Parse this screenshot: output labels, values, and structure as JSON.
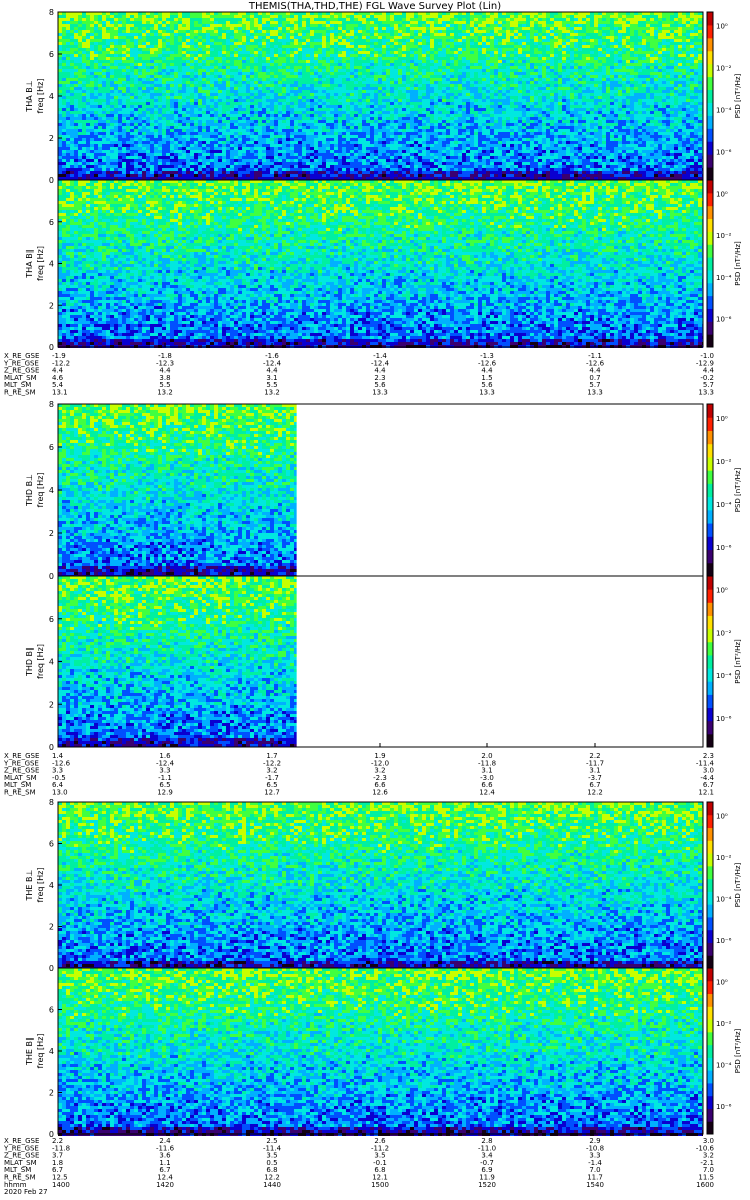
{
  "title": "THEMIS(THA,THD,THE) FGL Wave Survey Plot (Lin)",
  "colors": {
    "colormap": [
      "#140014",
      "#3a0070",
      "#0a00d0",
      "#0050ff",
      "#00b0ff",
      "#00e8e0",
      "#00f0a0",
      "#40ff40",
      "#c8ff00",
      "#ffe000",
      "#ff9000",
      "#ff2000",
      "#c00000"
    ],
    "unfilled": "#ffffff",
    "axis": "#000000"
  },
  "chart_data": [
    {
      "type": "heatmap",
      "group": "THA",
      "panels": [
        {
          "ylabel": "THA B⊥",
          "ylabel2": "freq [Hz]",
          "ylim": [
            0,
            8
          ],
          "yticks": [
            "0",
            "2",
            "4",
            "6",
            "8"
          ],
          "cbar_label": "PSD [nT²/Hz]",
          "cbar_ticks": [
            "10⁰",
            "10⁻²",
            "10⁻⁴",
            "10⁻⁶"
          ],
          "data_coverage": 1.0
        },
        {
          "ylabel": "THA B∥",
          "ylabel2": "freq [Hz]",
          "ylim": [
            0,
            8
          ],
          "yticks": [
            "0",
            "2",
            "4",
            "6"
          ],
          "cbar_label": "PSD [nT²/Hz]",
          "cbar_ticks": [
            "10⁰",
            "10⁻²",
            "10⁻⁴",
            "10⁻⁶"
          ],
          "data_coverage": 1.0
        }
      ],
      "ephemeris": {
        "labels": [
          "X_RE_GSE",
          "Y_RE_GSE",
          "Z_RE_GSE",
          "MLAT_SM",
          "MLT_SM",
          "R_RE_SM"
        ],
        "rows": [
          [
            "-1.9",
            "-1.8",
            "-1.6",
            "-1.4",
            "-1.3",
            "-1.1",
            "-1.0"
          ],
          [
            "-12.2",
            "-12.3",
            "-12.4",
            "-12.4",
            "-12.6",
            "-12.6",
            "-12.9"
          ],
          [
            "4.4",
            "4.4",
            "4.4",
            "4.4",
            "4.4",
            "4.4",
            "4.4"
          ],
          [
            "4.6",
            "3.8",
            "3.1",
            "2.3",
            "1.5",
            "0.7",
            "-0.2"
          ],
          [
            "5.4",
            "5.5",
            "5.5",
            "5.6",
            "5.6",
            "5.7",
            "5.7"
          ],
          [
            "13.1",
            "13.2",
            "13.2",
            "13.3",
            "13.3",
            "13.3",
            "13.3"
          ]
        ]
      }
    },
    {
      "type": "heatmap",
      "group": "THD",
      "panels": [
        {
          "ylabel": "THD B⊥",
          "ylabel2": "freq [Hz]",
          "ylim": [
            0,
            8
          ],
          "yticks": [
            "0",
            "2",
            "4",
            "6",
            "8"
          ],
          "cbar_label": "PSD [nT²/Hz]",
          "cbar_ticks": [
            "10⁰",
            "10⁻²",
            "10⁻⁴",
            "10⁻⁶"
          ],
          "data_coverage": 0.37
        },
        {
          "ylabel": "THD B∥",
          "ylabel2": "freq [Hz]",
          "ylim": [
            0,
            8
          ],
          "yticks": [
            "0",
            "2",
            "4",
            "6"
          ],
          "cbar_label": "PSD [nT²/Hz]",
          "cbar_ticks": [
            "10⁰",
            "10⁻²",
            "10⁻⁴",
            "10⁻⁶"
          ],
          "data_coverage": 0.37
        }
      ],
      "ephemeris": {
        "labels": [
          "X_RE_GSE",
          "Y_RE_GSE",
          "Z_RE_GSE",
          "MLAT_SM",
          "MLT_SM",
          "R_RE_SM"
        ],
        "rows": [
          [
            "1.4",
            "1.6",
            "1.7",
            "1.9",
            "2.0",
            "2.2",
            "2.3"
          ],
          [
            "-12.6",
            "-12.4",
            "-12.2",
            "-12.0",
            "-11.8",
            "-11.7",
            "-11.4"
          ],
          [
            "3.3",
            "3.3",
            "3.2",
            "3.2",
            "3.1",
            "3.1",
            "3.0"
          ],
          [
            "-0.5",
            "-1.1",
            "-1.7",
            "-2.3",
            "-3.0",
            "-3.7",
            "-4.4"
          ],
          [
            "6.4",
            "6.5",
            "6.5",
            "6.6",
            "6.6",
            "6.7",
            "6.7"
          ],
          [
            "13.0",
            "12.9",
            "12.7",
            "12.6",
            "12.4",
            "12.2",
            "12.1"
          ]
        ]
      }
    },
    {
      "type": "heatmap",
      "group": "THE",
      "panels": [
        {
          "ylabel": "THE B⊥",
          "ylabel2": "freq [Hz]",
          "ylim": [
            0,
            8
          ],
          "yticks": [
            "0",
            "2",
            "4",
            "6",
            "8"
          ],
          "cbar_label": "PSD [nT²/Hz]",
          "cbar_ticks": [
            "10⁰",
            "10⁻²",
            "10⁻⁴",
            "10⁻⁶"
          ],
          "data_coverage": 1.0
        },
        {
          "ylabel": "THE B∥",
          "ylabel2": "freq [Hz]",
          "ylim": [
            0,
            8
          ],
          "yticks": [
            "0",
            "2",
            "4",
            "6"
          ],
          "cbar_label": "PSD [nT²/Hz]",
          "cbar_ticks": [
            "10⁰",
            "10⁻²",
            "10⁻⁴",
            "10⁻⁶"
          ],
          "data_coverage": 1.0
        }
      ],
      "ephemeris": {
        "labels": [
          "X_RE_GSE",
          "Y_RE_GSE",
          "Z_RE_GSE",
          "MLAT_SM",
          "MLT_SM",
          "R_RE_SM",
          "hhmm",
          "2020 Feb 27"
        ],
        "rows": [
          [
            "2.2",
            "2.4",
            "2.5",
            "2.6",
            "2.8",
            "2.9",
            "3.0"
          ],
          [
            "-11.8",
            "-11.6",
            "-11.4",
            "-11.2",
            "-11.0",
            "-10.8",
            "-10.6"
          ],
          [
            "3.7",
            "3.6",
            "3.5",
            "3.5",
            "3.4",
            "3.3",
            "3.2"
          ],
          [
            "1.8",
            "1.1",
            "0.5",
            "-0.1",
            "-0.7",
            "-1.4",
            "-2.1"
          ],
          [
            "6.7",
            "6.7",
            "6.8",
            "6.8",
            "6.9",
            "7.0",
            "7.0"
          ],
          [
            "12.5",
            "12.4",
            "12.2",
            "12.1",
            "11.9",
            "11.7",
            "11.5"
          ],
          [
            "1400",
            "1420",
            "1440",
            "1500",
            "1520",
            "1540",
            "1600"
          ]
        ]
      }
    }
  ]
}
